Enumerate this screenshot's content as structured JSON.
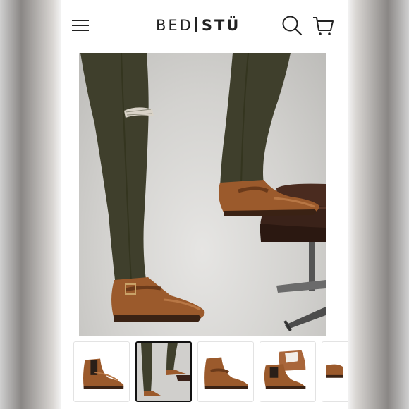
{
  "header": {
    "brand_left": "BED",
    "brand_right": "STÜ",
    "icons": [
      "hamburger-menu-icon",
      "search-icon",
      "shopping-cart-icon"
    ]
  },
  "gallery": {
    "main_image": "model-wearing-brown-leather-boots",
    "thumbnails": [
      {
        "name": "side-view-boot"
      },
      {
        "name": "model-standing-boots",
        "selected": true
      },
      {
        "name": "boot-side-profile"
      },
      {
        "name": "boots-pair-angle"
      },
      {
        "name": "boot-partial"
      }
    ]
  },
  "colors": {
    "leather": "#9b5a2c",
    "pants": "#3f3f2c",
    "background": "#d3d2cf"
  }
}
